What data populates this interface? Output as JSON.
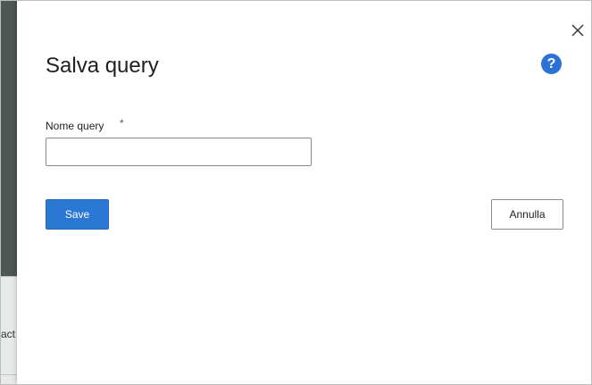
{
  "background": {
    "fragment_text": "act"
  },
  "dialog": {
    "title": "Salva query",
    "help_icon": "help-icon",
    "close_icon": "close-icon",
    "fields": {
      "query_name": {
        "label": "Nome query",
        "required_mark": "*",
        "value": "",
        "placeholder": ""
      }
    },
    "buttons": {
      "save_label": "Save",
      "cancel_label": "Annulla"
    },
    "help_glyph": "?"
  },
  "colors": {
    "primary": "#2b78d4",
    "help": "#2b72d6",
    "sidebar_dark": "#4e5656"
  }
}
